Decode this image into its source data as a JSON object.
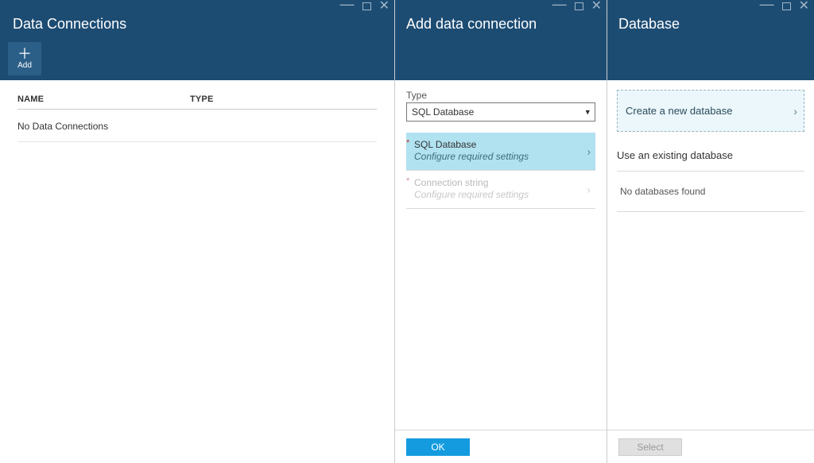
{
  "blade1": {
    "title": "Data Connections",
    "toolbar": {
      "add_label": "Add"
    },
    "columns": {
      "name": "NAME",
      "type": "TYPE"
    },
    "empty": "No Data Connections"
  },
  "blade2": {
    "title": "Add data connection",
    "type_label": "Type",
    "type_value": "SQL Database",
    "rows": [
      {
        "title": "SQL Database",
        "sub": "Configure required settings"
      },
      {
        "title": "Connection string",
        "sub": "Configure required settings"
      }
    ],
    "ok": "OK"
  },
  "blade3": {
    "title": "Database",
    "create": "Create a new database",
    "existing_header": "Use an existing database",
    "no_db": "No databases found",
    "select": "Select"
  }
}
